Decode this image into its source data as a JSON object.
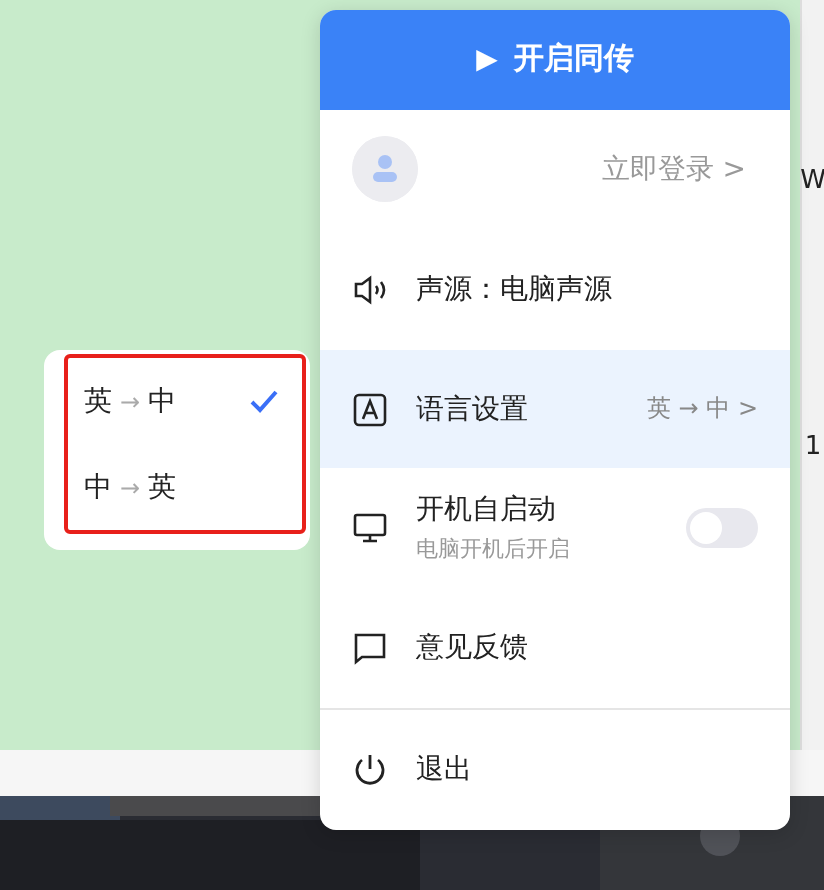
{
  "background": {
    "edge_texts": [
      "W",
      "1"
    ]
  },
  "menu": {
    "start_button": {
      "icon": "▶",
      "label": "开启同传"
    },
    "login": {
      "label": "立即登录",
      "chevron": ">"
    },
    "items": [
      {
        "kind": "source",
        "label": "声源：电脑声源"
      },
      {
        "kind": "language",
        "label": "语言设置",
        "value": "英 → 中",
        "chevron": ">",
        "selected": true
      },
      {
        "kind": "toggle",
        "label": "开机自启动",
        "sublabel": "电脑开机后开启",
        "on": false
      },
      {
        "kind": "feedback",
        "label": "意见反馈"
      },
      {
        "kind": "exit",
        "label": "退出"
      }
    ]
  },
  "language_popup": {
    "highlighted": true,
    "options": [
      {
        "from": "英",
        "arrow": "→",
        "to": "中",
        "selected": true
      },
      {
        "from": "中",
        "arrow": "→",
        "to": "英",
        "selected": false
      }
    ]
  }
}
